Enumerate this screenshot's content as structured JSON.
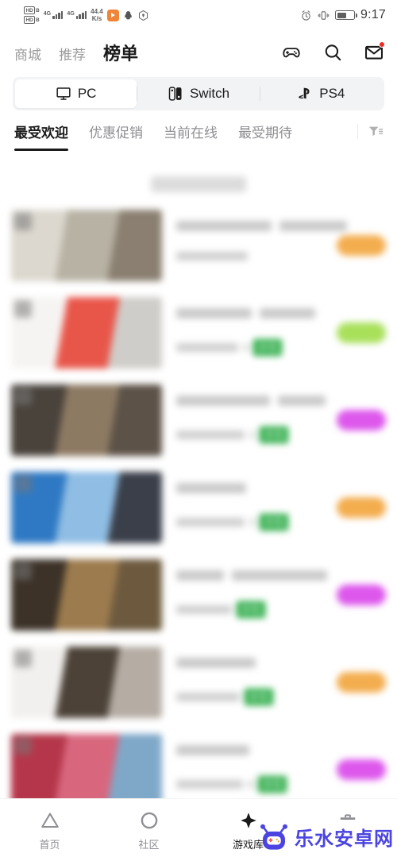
{
  "status_bar": {
    "hd_label_top": "HD",
    "hd_sub_top": "B",
    "hd_label_bottom": "HD",
    "hd_sub_bottom": "B",
    "network_type_1": "4G",
    "network_type_2": "4G",
    "net_speed_value": "44.4",
    "net_speed_unit": "K/s",
    "icons": [
      "video-app-icon",
      "qq-penguin-icon",
      "shield-icon",
      "alarm-icon",
      "vibrate-icon",
      "battery-icon"
    ],
    "time": "9:17"
  },
  "header": {
    "nav": [
      {
        "label": "商城",
        "active": false
      },
      {
        "label": "推荐",
        "active": false
      },
      {
        "label": "榜单",
        "active": true
      }
    ],
    "icons": [
      {
        "name": "gamepad-icon",
        "badge": false
      },
      {
        "name": "search-icon",
        "badge": false
      },
      {
        "name": "mail-icon",
        "badge": true
      }
    ]
  },
  "platform_tabs": {
    "items": [
      {
        "label": "PC",
        "icon": "monitor-icon",
        "active": true
      },
      {
        "label": "Switch",
        "icon": "switch-icon",
        "active": false
      },
      {
        "label": "PS4",
        "icon": "playstation-icon",
        "active": false
      }
    ]
  },
  "filter_tabs": {
    "items": [
      {
        "label": "最受欢迎",
        "active": true
      },
      {
        "label": "优惠促销",
        "active": false
      },
      {
        "label": "当前在线",
        "active": false
      },
      {
        "label": "最受期待",
        "active": false
      }
    ],
    "filter_icon": "filter-funnel-icon"
  },
  "list": {
    "loading_indicator": true,
    "rows": [
      {
        "rank": "1",
        "title_widths": [
          120,
          85
        ],
        "price_width": 90,
        "price_num": "",
        "low_badge": "",
        "has_low_badge": false,
        "action_color": "#f3ad4e",
        "thumb_colors": [
          "#dcd8cf",
          "#b8b2a4",
          "#8a7f70"
        ]
      },
      {
        "rank": "2",
        "title_widths": [
          95,
          70
        ],
        "price_width": 78,
        "price_num": "9",
        "low_badge": "史低",
        "has_low_badge": true,
        "action_color": "#a8e05a",
        "thumb_colors": [
          "#f6f4f2",
          "#e8564a",
          "#cfcdc9"
        ]
      },
      {
        "rank": "3",
        "title_widths": [
          118,
          60
        ],
        "price_width": 86,
        "price_num": "3",
        "low_badge": "史低",
        "has_low_badge": true,
        "action_color": "#dd57ec",
        "thumb_colors": [
          "#4a433c",
          "#8d7a63",
          "#5c5247"
        ]
      },
      {
        "rank": "4",
        "title_widths": [
          88,
          0
        ],
        "price_width": 86,
        "price_num": "3",
        "low_badge": "史低",
        "has_low_badge": true,
        "action_color": "#f3ad4e",
        "thumb_colors": [
          "#2f79c4",
          "#8fbde4",
          "#3a3f4a"
        ]
      },
      {
        "rank": "5",
        "title_widths": [
          60,
          120
        ],
        "price_width": 70,
        "price_num": "",
        "low_badge": "史低",
        "has_low_badge": true,
        "action_color": "#dd57ec",
        "thumb_colors": [
          "#3c3228",
          "#9c7b4e",
          "#6d5a3e"
        ]
      },
      {
        "rank": "6",
        "title_widths": [
          100,
          0
        ],
        "price_width": 80,
        "price_num": "",
        "low_badge": "史低",
        "has_low_badge": true,
        "action_color": "#f3ad4e",
        "thumb_colors": [
          "#f2f0ee",
          "#4c4238",
          "#b5ada4"
        ]
      },
      {
        "rank": "7",
        "title_widths": [
          92,
          0
        ],
        "price_width": 84,
        "price_num": "8",
        "low_badge": "史低",
        "has_low_badge": true,
        "action_color": "#dd57ec",
        "thumb_colors": [
          "#b5364a",
          "#d8677e",
          "#7fa8c8"
        ]
      }
    ]
  },
  "bottom_nav": {
    "items": [
      {
        "label": "首页",
        "icon": "triangle-icon",
        "active": false
      },
      {
        "label": "社区",
        "icon": "circle-icon",
        "active": false
      },
      {
        "label": "游戏库",
        "icon": "x-burst-icon",
        "active": true
      },
      {
        "label": "",
        "icon": "briefcase-icon",
        "active": false
      }
    ]
  },
  "watermark": {
    "text": "乐水安卓网",
    "logo": "robot-logo-icon",
    "color": "#4b44e0"
  }
}
